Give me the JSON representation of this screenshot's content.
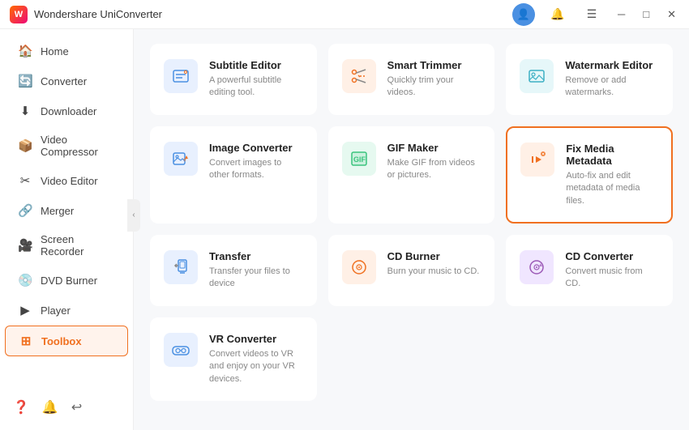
{
  "titlebar": {
    "app_name": "Wondershare UniConverter",
    "logo_text": "W"
  },
  "sidebar": {
    "items": [
      {
        "id": "home",
        "label": "Home",
        "icon": "🏠"
      },
      {
        "id": "converter",
        "label": "Converter",
        "icon": "🔄"
      },
      {
        "id": "downloader",
        "label": "Downloader",
        "icon": "⬇"
      },
      {
        "id": "video-compressor",
        "label": "Video Compressor",
        "icon": "📦"
      },
      {
        "id": "video-editor",
        "label": "Video Editor",
        "icon": "✂"
      },
      {
        "id": "merger",
        "label": "Merger",
        "icon": "🔗"
      },
      {
        "id": "screen-recorder",
        "label": "Screen Recorder",
        "icon": "🎥"
      },
      {
        "id": "dvd-burner",
        "label": "DVD Burner",
        "icon": "💿"
      },
      {
        "id": "player",
        "label": "Player",
        "icon": "▶"
      },
      {
        "id": "toolbox",
        "label": "Toolbox",
        "icon": "⊞",
        "active": true
      }
    ],
    "bottom_icons": [
      "❓",
      "🔔",
      "↩"
    ]
  },
  "tools": [
    {
      "id": "subtitle-editor",
      "title": "Subtitle Editor",
      "desc": "A powerful subtitle editing tool.",
      "icon_color": "blue"
    },
    {
      "id": "smart-trimmer",
      "title": "Smart Trimmer",
      "desc": "Quickly trim your videos.",
      "icon_color": "orange"
    },
    {
      "id": "watermark-editor",
      "title": "Watermark Editor",
      "desc": "Remove or add watermarks.",
      "icon_color": "teal"
    },
    {
      "id": "image-converter",
      "title": "Image Converter",
      "desc": "Convert images to other formats.",
      "icon_color": "blue"
    },
    {
      "id": "gif-maker",
      "title": "GIF Maker",
      "desc": "Make GIF from videos or pictures.",
      "icon_color": "green"
    },
    {
      "id": "fix-media-metadata",
      "title": "Fix Media Metadata",
      "desc": "Auto-fix and edit metadata of media files.",
      "icon_color": "orange",
      "highlighted": true
    },
    {
      "id": "transfer",
      "title": "Transfer",
      "desc": "Transfer your files to device",
      "icon_color": "blue"
    },
    {
      "id": "cd-burner",
      "title": "CD Burner",
      "desc": "Burn your music to CD.",
      "icon_color": "orange"
    },
    {
      "id": "cd-converter",
      "title": "CD Converter",
      "desc": "Convert music from CD.",
      "icon_color": "purple"
    },
    {
      "id": "vr-converter",
      "title": "VR Converter",
      "desc": "Convert videos to VR and enjoy on your VR devices.",
      "icon_color": "blue"
    }
  ]
}
